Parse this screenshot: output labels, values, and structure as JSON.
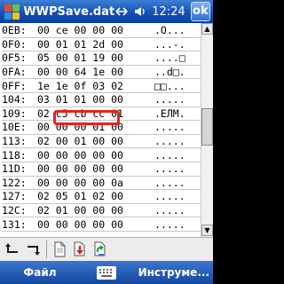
{
  "titlebar": {
    "title": "WWPSave.dat",
    "clock": "12:24",
    "ok_label": "ok",
    "icons": [
      "windows-start-icon",
      "connectivity-icon",
      "speaker-icon"
    ]
  },
  "hex": {
    "rows": [
      {
        "addr": "0EB:",
        "bytes": "00 ce 00 00 00",
        "ascii": ".O..."
      },
      {
        "addr": "0F0:",
        "bytes": "00 01 01 2d 00",
        "ascii": "...-."
      },
      {
        "addr": "0F5:",
        "bytes": "05 00 01 19 00",
        "ascii": "....□"
      },
      {
        "addr": "0FA:",
        "bytes": "00 00 64 1e 00",
        "ascii": "..d□."
      },
      {
        "addr": "0FF:",
        "bytes": "1e 1e 0f 03 02",
        "ascii": "□□..."
      },
      {
        "addr": "104:",
        "bytes": "03 01 01 00 00",
        "ascii": "....."
      },
      {
        "addr": "109:",
        "bytes": "02 c5 cb cc 01",
        "ascii": ".ЕЛМ."
      },
      {
        "addr": "10E:",
        "bytes": "00 00 00 01 00",
        "ascii": "....."
      },
      {
        "addr": "113:",
        "bytes": "02 00 01 00 00",
        "ascii": "....."
      },
      {
        "addr": "118:",
        "bytes": "00 00 00 00 00",
        "ascii": "....."
      },
      {
        "addr": "11D:",
        "bytes": "00 00 00 00 00",
        "ascii": "....."
      },
      {
        "addr": "122:",
        "bytes": "00 00 00 00 0a",
        "ascii": "....."
      },
      {
        "addr": "127:",
        "bytes": "02 05 01 02 00",
        "ascii": "....."
      },
      {
        "addr": "12C:",
        "bytes": "02 01 00 00 00",
        "ascii": "....."
      },
      {
        "addr": "131:",
        "bytes": "00 00 00 00 00",
        "ascii": "....."
      }
    ]
  },
  "toolbar": {
    "buttons": [
      "undo-icon",
      "redo-icon",
      "new-document-icon",
      "save-icon",
      "refresh-icon"
    ]
  },
  "menubar": {
    "left": "Файл",
    "right": "Инструме..."
  },
  "colors": {
    "titlebar": "#1450b8",
    "highlight": "#e8211c"
  }
}
